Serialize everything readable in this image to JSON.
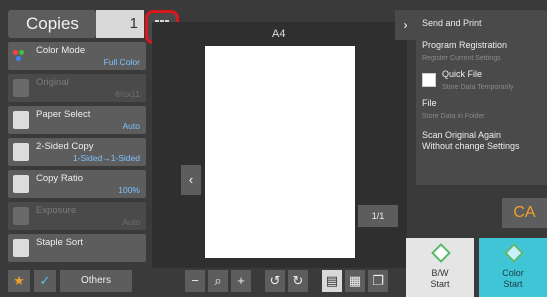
{
  "header": {
    "title": "Copies",
    "count": "1"
  },
  "functions": [
    {
      "label": "Color Mode",
      "value": "Full Color",
      "enabled": true
    },
    {
      "label": "Original",
      "value": "8½x11",
      "enabled": false
    },
    {
      "label": "Paper Select",
      "value": "Auto",
      "enabled": true
    },
    {
      "label": "2-Sided Copy",
      "value": "1-Sided→1-Sided",
      "enabled": true
    },
    {
      "label": "Copy Ratio",
      "value": "100%",
      "enabled": true
    },
    {
      "label": "Exposure",
      "value": "Auto",
      "enabled": false
    },
    {
      "label": "Staple Sort",
      "value": "",
      "enabled": true
    }
  ],
  "bottom_left": {
    "others_label": "Others"
  },
  "preview": {
    "paper_size": "A4",
    "page_counter": "1/1"
  },
  "right_panel": {
    "send_and_print": "Send and Print",
    "program_registration": "Program Registration",
    "register_current_settings": "Register Current Settings",
    "quick_file": "Quick File",
    "store_temporarily": "Store Data Temporarily",
    "file": "File",
    "store_in_folder": "Store Data in Folder",
    "scan_again_line1": "Scan Original Again",
    "scan_again_line2": "Without change Settings"
  },
  "ca_label": "CA",
  "start_bw": {
    "line1": "B/W",
    "line2": "Start"
  },
  "start_color": {
    "line1": "Color",
    "line2": "Start"
  },
  "colors": {
    "accent_red": "#d8181f",
    "value_blue": "#7ec3ff",
    "color_start": "#3fc5d5",
    "ca_orange": "#f0a030"
  }
}
